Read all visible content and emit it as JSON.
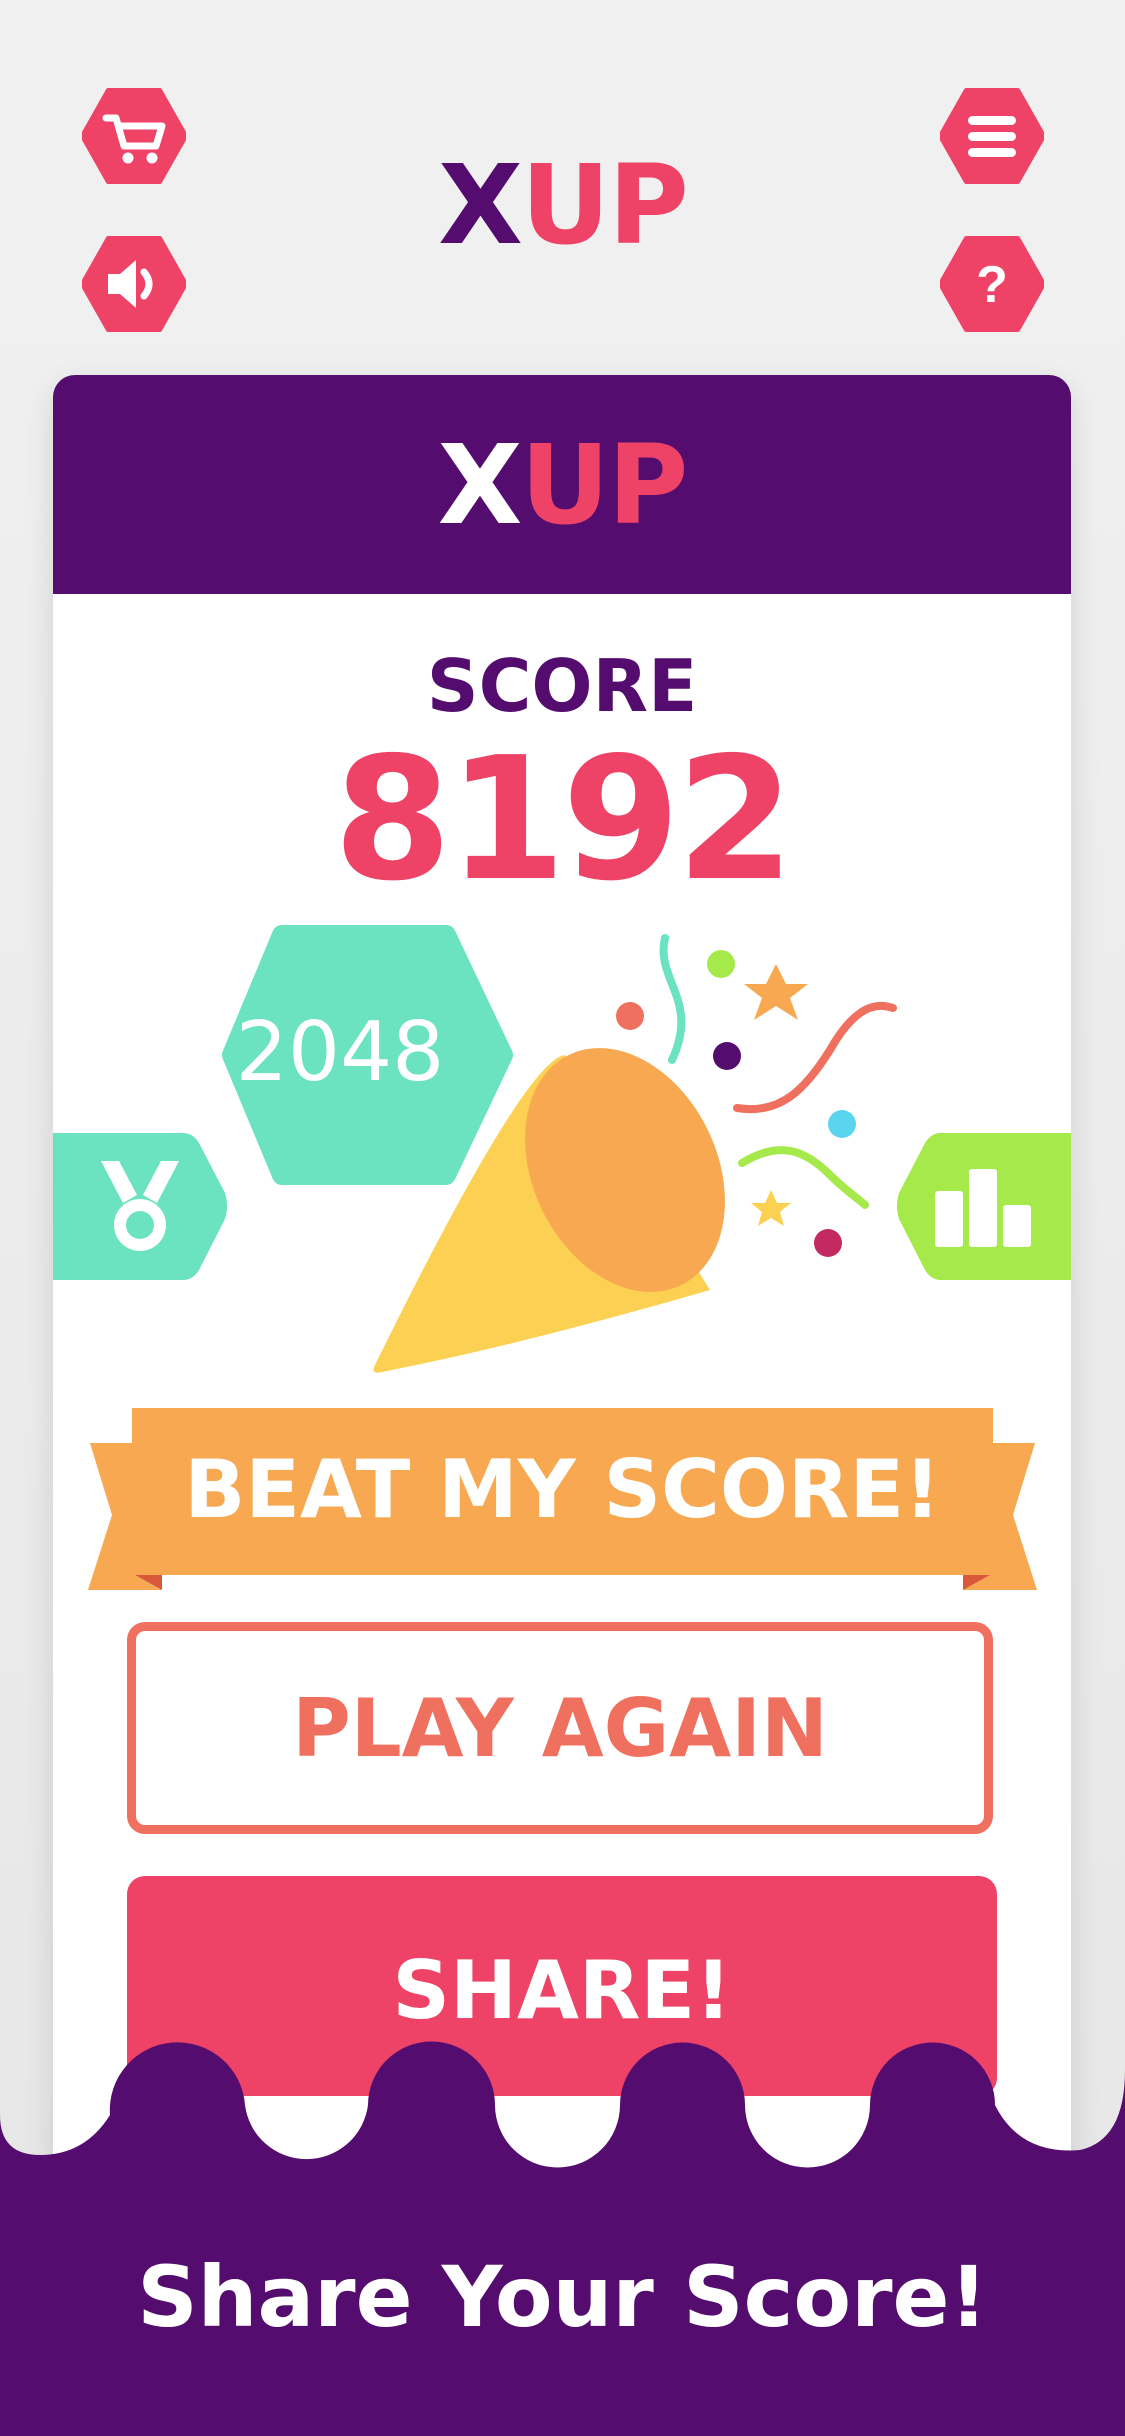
{
  "header": {
    "logo_x": "X",
    "logo_up": "UP",
    "icons": [
      "cart-icon",
      "menu-icon",
      "sound-icon",
      "help-icon"
    ]
  },
  "card": {
    "logo_x": "X",
    "logo_up": "UP",
    "score_label": "SCORE",
    "score_value": "8192",
    "tile_value": "2048",
    "left_badge_icon": "medal-icon",
    "right_badge_icon": "leaderboard-icon",
    "ribbon_text": "BEAT MY SCORE!",
    "play_again_label": "PLAY AGAIN",
    "share_label": "SHARE!"
  },
  "caption": "Share Your Score!",
  "colors": {
    "purple": "#540D6E",
    "pink": "#EE4266",
    "coral": "#F0705F",
    "mint": "#6BE2C0",
    "orange": "#F7A850",
    "lime": "#A6E94B",
    "yellow": "#FCD052"
  }
}
